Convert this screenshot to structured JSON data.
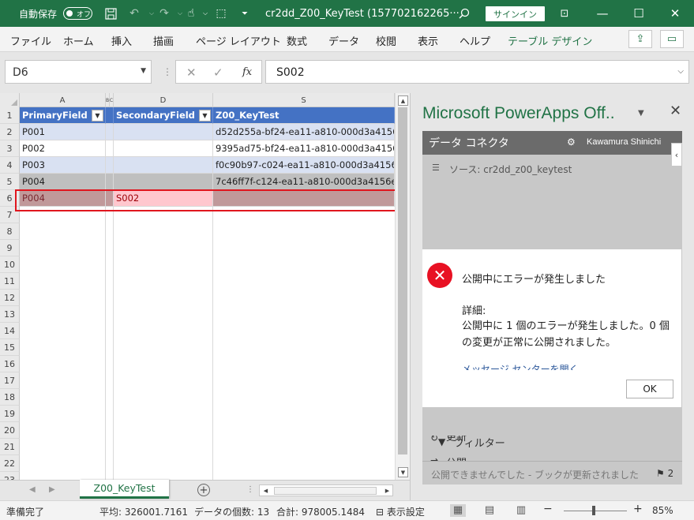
{
  "titlebar": {
    "autosave_label": "自動保存",
    "toggle_label": "オフ",
    "save_icon": "save-icon",
    "title": "cr2dd_Z00_KeyTest (157702162265···",
    "signin_label": "サインイン",
    "minimize": "—",
    "maximize": "☐",
    "close": "✕"
  },
  "ribbon": {
    "tabs": [
      "ファイル",
      "ホーム",
      "挿入",
      "描画",
      "ページ レイアウト",
      "数式",
      "データ",
      "校閲",
      "表示",
      "ヘルプ",
      "テーブル デザイン"
    ],
    "accent": "#217346"
  },
  "formula_bar": {
    "name_box": "D6",
    "fx_label": "fx",
    "content": "S002"
  },
  "grid": {
    "columns": [
      "A",
      "B",
      "C",
      "D",
      "S"
    ],
    "headers": [
      "PrimaryField",
      "SecondaryField",
      "Z00_KeyTest"
    ],
    "rows": [
      {
        "num": "2",
        "a": "P001",
        "d": "",
        "s": "d52d255a-bf24-ea11-a810-000d3a4156"
      },
      {
        "num": "3",
        "a": "P002",
        "d": "",
        "s": "9395ad75-bf24-ea11-a810-000d3a4156"
      },
      {
        "num": "4",
        "a": "P003",
        "d": "",
        "s": "f0c90b97-c024-ea11-a810-000d3a4156"
      },
      {
        "num": "5",
        "a": "P004",
        "d": "",
        "s": "7c46ff7f-c124-ea11-a810-000d3a4156e"
      },
      {
        "num": "6",
        "a": "P004",
        "d": "S002",
        "s": ""
      }
    ],
    "empty_rows": [
      "7",
      "8",
      "9",
      "10",
      "11",
      "12",
      "13",
      "14",
      "15",
      "16",
      "17",
      "18",
      "19",
      "20",
      "21",
      "22",
      "23"
    ],
    "header_row_num": "1"
  },
  "sheet_tab": {
    "name": "Z00_KeyTest",
    "add_label": "+"
  },
  "pane": {
    "title": "Microsoft PowerApps Off..",
    "addin_title": "データ コネクタ",
    "user": "Kawamura Shinichi",
    "source_label": "ソース: cr2dd_z00_keytest",
    "menu": [
      {
        "icon": "refresh-icon",
        "glyph": "↻",
        "label": "更新"
      },
      {
        "icon": "publish-icon",
        "glyph": "⇉",
        "label": "公開"
      },
      {
        "icon": "filter-icon",
        "glyph": "▼",
        "label": "フィルター"
      }
    ],
    "footer_text": "公開できませんでした - ブックが更新されました",
    "footer_flag": "2"
  },
  "dialog": {
    "heading": "公開中にエラーが発生しました",
    "detail_label": "詳細:",
    "message": "公開中に 1 個のエラーが発生しました。0 個の変更が正常に公開されました。",
    "link": "メッセージ センターを開く",
    "ok_label": "OK"
  },
  "status": {
    "ready": "準備完了",
    "average": "平均: 326001.7161",
    "count": "データの個数: 13",
    "sum": "合計: 978005.1484",
    "display_settings": "表示設定",
    "zoom": "85%"
  }
}
